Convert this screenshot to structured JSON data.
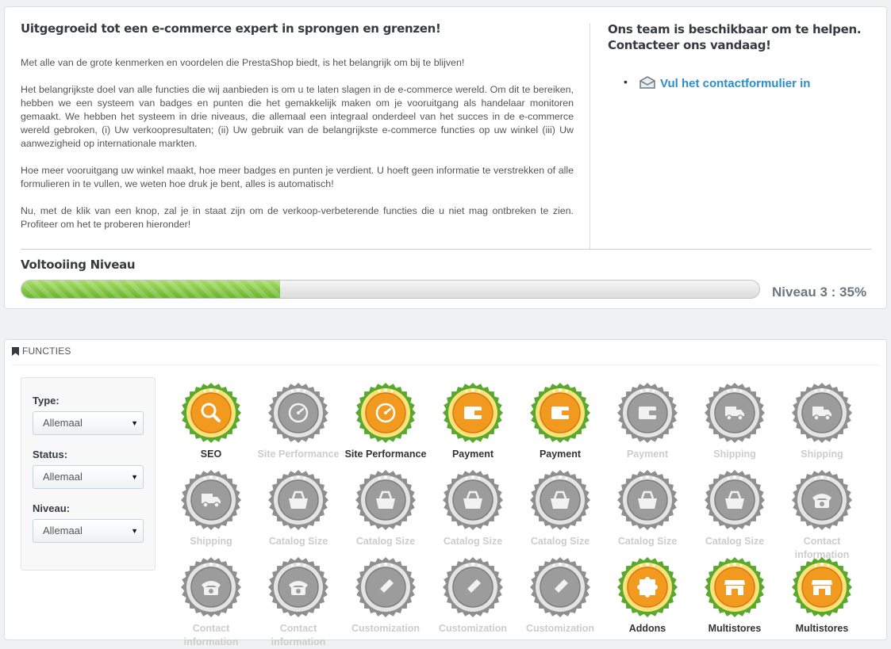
{
  "intro": {
    "title": "Uitgegroeid tot een e-commerce expert in sprongen en grenzen!",
    "paragraphs": [
      "Met alle van de grote kenmerken en voordelen die PrestaShop biedt, is het belangrijk om bij te blijven!",
      "Het belangrijkste doel van alle functies die wij aanbieden is om u te laten slagen in de e-commerce wereld. Om dit te bereiken, hebben we een systeem van badges en punten die het gemakkelijk maken om je vooruitgang als handelaar monitoren gemaakt. We hebben het systeem in drie niveaus, die allemaal een integraal onderdeel van het succes in de e-commerce wereld gebroken, (i) Uw verkoopresultaten; (ii) Uw gebruik van de belangrijkste e-commerce functies op uw winkel (iii) Uw aanwezigheid op internationale markten.",
      "Hoe meer vooruitgang uw winkel maakt, hoe meer badges en punten je verdient. U hoeft geen informatie te verstrekken of alle formulieren in te vullen, we weten hoe druk je bent, alles is automatisch!",
      "Nu, met de klik van een knop, zal je in staat zijn om de verkoop-verbeterende functies die u niet mag ontbreken te zien. Profiteer om het te proberen hieronder!"
    ],
    "help_title": "Ons team is beschikbaar om te helpen. Contacteer ons vandaag!",
    "contact_link": "Vul het contactformulier in",
    "contact_icon": "envelope-icon"
  },
  "level": {
    "title": "Voltooiing Niveau",
    "progress_percent": 35,
    "text": "Niveau 3 : 35%"
  },
  "features": {
    "heading": "FUNCTIES",
    "heading_icon": "bookmark-icon",
    "filters": [
      {
        "label": "Type:",
        "value": "Allemaal"
      },
      {
        "label": "Status:",
        "value": "Allemaal"
      },
      {
        "label": "Niveau:",
        "value": "Allemaal"
      }
    ],
    "badges": [
      {
        "label": "SEO",
        "on": true,
        "icon": "magnifier-icon"
      },
      {
        "label": "Site Performance",
        "on": false,
        "icon": "speedometer-icon"
      },
      {
        "label": "Site Performance",
        "on": true,
        "icon": "speedometer-icon"
      },
      {
        "label": "Payment",
        "on": true,
        "icon": "wallet-icon"
      },
      {
        "label": "Payment",
        "on": true,
        "icon": "wallet-icon"
      },
      {
        "label": "Payment",
        "on": false,
        "icon": "wallet-icon"
      },
      {
        "label": "Shipping",
        "on": false,
        "icon": "truck-icon"
      },
      {
        "label": "Shipping",
        "on": false,
        "icon": "truck-icon"
      },
      {
        "label": "Shipping",
        "on": false,
        "icon": "truck-icon"
      },
      {
        "label": "Catalog Size",
        "on": false,
        "icon": "bag-icon"
      },
      {
        "label": "Catalog Size",
        "on": false,
        "icon": "bag-icon"
      },
      {
        "label": "Catalog Size",
        "on": false,
        "icon": "bag-icon"
      },
      {
        "label": "Catalog Size",
        "on": false,
        "icon": "bag-icon"
      },
      {
        "label": "Catalog Size",
        "on": false,
        "icon": "bag-icon"
      },
      {
        "label": "Catalog Size",
        "on": false,
        "icon": "bag-icon"
      },
      {
        "label": "Contact information",
        "on": false,
        "icon": "telephone-icon"
      },
      {
        "label": "Contact information",
        "on": false,
        "icon": "telephone-icon"
      },
      {
        "label": "Contact information",
        "on": false,
        "icon": "telephone-icon"
      },
      {
        "label": "Customization",
        "on": false,
        "icon": "pencil-icon"
      },
      {
        "label": "Customization",
        "on": false,
        "icon": "pencil-icon"
      },
      {
        "label": "Customization",
        "on": false,
        "icon": "pencil-icon"
      },
      {
        "label": "Addons",
        "on": true,
        "icon": "puzzle-icon"
      },
      {
        "label": "Multistores",
        "on": true,
        "icon": "store-icon"
      },
      {
        "label": "Multistores",
        "on": true,
        "icon": "store-icon"
      }
    ]
  },
  "colors": {
    "accent_link": "#2a8fc7",
    "progress_green": "#67b529",
    "badge_green_rim": "#5aa92f",
    "badge_orange": "#f29a1f",
    "badge_grey": "#9a9a9a"
  }
}
